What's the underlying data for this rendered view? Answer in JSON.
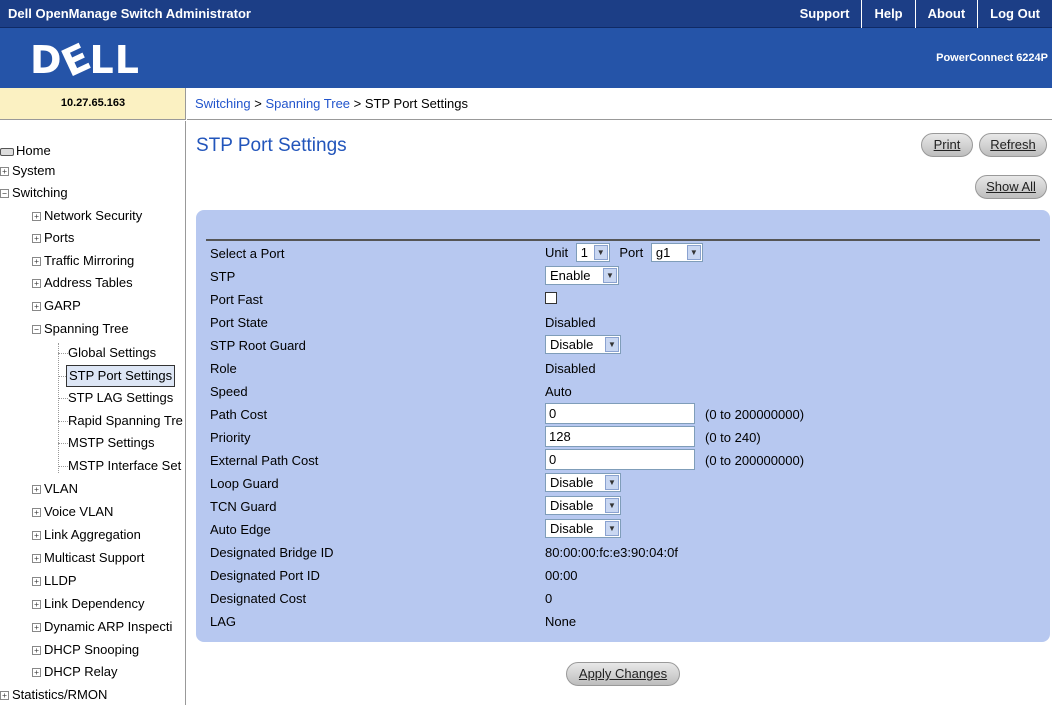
{
  "topbar": {
    "title": "Dell OpenManage Switch Administrator",
    "links": [
      "Support",
      "Help",
      "About",
      "Log Out"
    ]
  },
  "banner": {
    "logo": "DELL",
    "product": "PowerConnect 6224P"
  },
  "ip_address": "10.27.65.163",
  "breadcrumb": {
    "part1": "Switching",
    "part2": "Spanning Tree",
    "part3": "STP Port Settings",
    "sep": " > "
  },
  "sidebar": {
    "home": "Home",
    "system": "System",
    "switching": "Switching",
    "network_security": "Network Security",
    "ports": "Ports",
    "traffic_mirroring": "Traffic Mirroring",
    "address_tables": "Address Tables",
    "garp": "GARP",
    "spanning_tree": "Spanning Tree",
    "global_settings": "Global Settings",
    "stp_port_settings": "STP Port Settings",
    "stp_lag_settings": "STP LAG Settings",
    "rapid_spanning_tree": "Rapid Spanning Tre",
    "mstp_settings": "MSTP Settings",
    "mstp_interface": "MSTP Interface Set",
    "vlan": "VLAN",
    "voice_vlan": "Voice VLAN",
    "link_aggregation": "Link Aggregation",
    "multicast_support": "Multicast Support",
    "lldp": "LLDP",
    "link_dependency": "Link Dependency",
    "dynamic_arp": "Dynamic ARP Inspecti",
    "dhcp_snooping": "DHCP Snooping",
    "dhcp_relay": "DHCP Relay",
    "statistics": "Statistics/RMON"
  },
  "page": {
    "title": "STP Port Settings",
    "print": "Print",
    "refresh": "Refresh",
    "show_all": "Show All",
    "apply": "Apply Changes"
  },
  "form": {
    "select_port": "Select a Port",
    "unit_label": "Unit",
    "unit_value": "1",
    "port_label": "Port",
    "port_value": "g1",
    "stp": "STP",
    "stp_value": "Enable",
    "port_fast": "Port Fast",
    "port_state": "Port State",
    "port_state_value": "Disabled",
    "root_guard": "STP Root Guard",
    "root_guard_value": "Disable",
    "role": "Role",
    "role_value": "Disabled",
    "speed": "Speed",
    "speed_value": "Auto",
    "path_cost": "Path Cost",
    "path_cost_value": "0",
    "path_cost_hint": "(0 to 200000000)",
    "priority": "Priority",
    "priority_value": "128",
    "priority_hint": "(0 to 240)",
    "ext_path_cost": "External Path Cost",
    "ext_path_cost_value": "0",
    "ext_path_cost_hint": "(0 to 200000000)",
    "loop_guard": "Loop Guard",
    "loop_guard_value": "Disable",
    "tcn_guard": "TCN Guard",
    "tcn_guard_value": "Disable",
    "auto_edge": "Auto Edge",
    "auto_edge_value": "Disable",
    "bridge_id": "Designated Bridge ID",
    "bridge_id_value": "80:00:00:fc:e3:90:04:0f",
    "port_id": "Designated Port ID",
    "port_id_value": "00:00",
    "designated_cost": "Designated Cost",
    "designated_cost_value": "0",
    "lag": "LAG",
    "lag_value": "None"
  }
}
